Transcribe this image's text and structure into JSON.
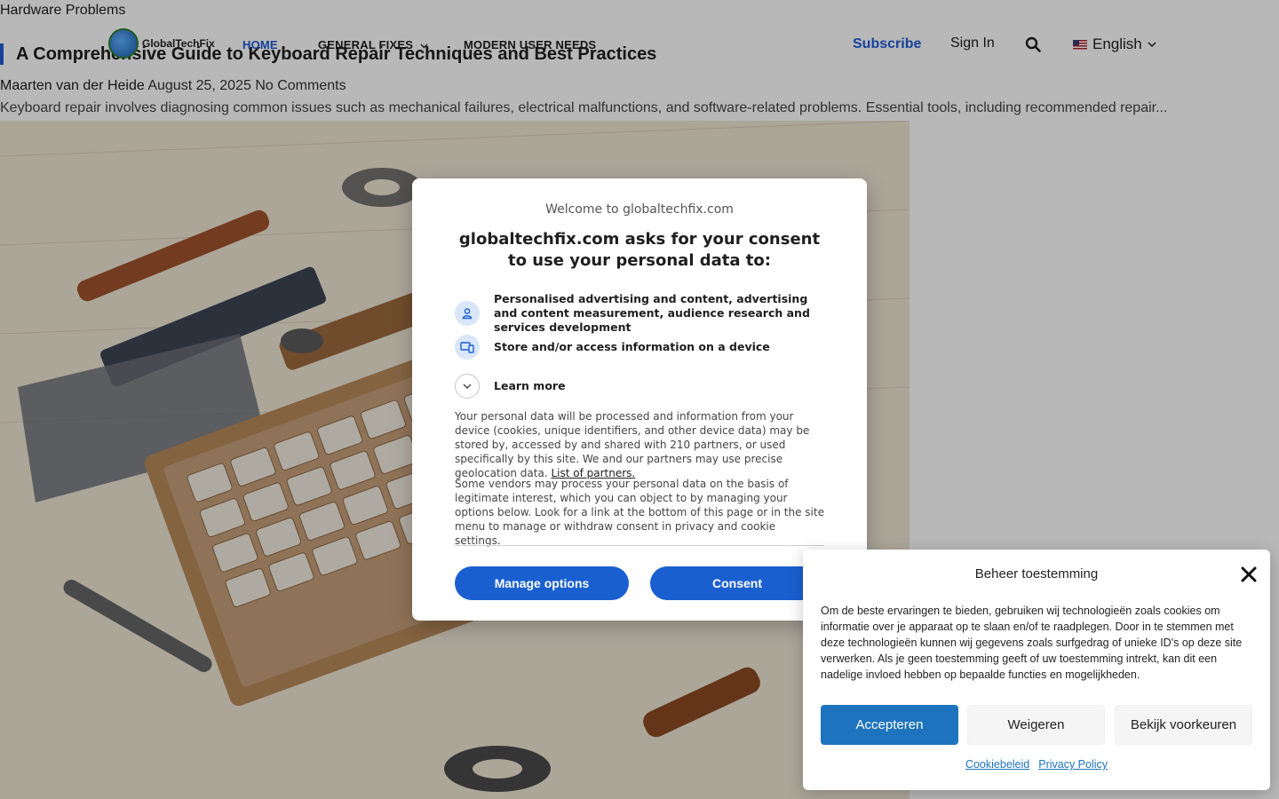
{
  "category": "Hardware Problems",
  "header": {
    "logo_text": "GlobalTechFix",
    "nav": [
      "HOME",
      "GENERAL FIXES",
      "MODERN USER NEEDS"
    ],
    "subscribe": "Subscribe",
    "signin": "Sign In",
    "language": "English"
  },
  "post": {
    "title": "A Comprehensive Guide to Keyboard Repair Techniques and Best Practices",
    "author": "Maarten van der Heide",
    "date": "August 25, 2025",
    "comments": "No Comments",
    "excerpt": "Keyboard repair involves diagnosing common issues such as mechanical failures, electrical malfunctions, and software-related problems. Essential tools, including recommended repair..."
  },
  "consent_modal": {
    "welcome": "Welcome to globaltechfix.com",
    "heading": "globaltechfix.com asks for your consent to use your personal data to:",
    "purposes": [
      "Personalised advertising and content, advertising and content measurement, audience research and services development",
      "Store and/or access information on a device",
      "Learn more"
    ],
    "body1": "Your personal data will be processed and information from your device (cookies, unique identifiers, and other device data) may be stored by, accessed by and shared with 210 partners, or used specifically by this site. We and our partners may use precise geolocation data.",
    "partners_link": "List of partners.",
    "body2": "Some vendors may process your personal data on the basis of legitimate interest, which you can object to by managing your options below. Look for a link at the bottom of this page or in the site menu to manage or withdraw consent in privacy and cookie settings.",
    "manage_button": "Manage options",
    "consent_button": "Consent"
  },
  "cookie_panel": {
    "title": "Beheer toestemming",
    "text": "Om de beste ervaringen te bieden, gebruiken wij technologieën zoals cookies om informatie over je apparaat op te slaan en/of te raadplegen. Door in te stemmen met deze technologieën kunnen wij gegevens zoals surfgedrag of unieke ID's op deze site verwerken. Als je geen toestemming geeft of uw toestemming intrekt, kan dit een nadelige invloed hebben op bepaalde functies en mogelijkheden.",
    "accept": "Accepteren",
    "deny": "Weigeren",
    "preferences": "Bekijk voorkeuren",
    "link_cookie": "Cookiebeleid",
    "link_privacy": "Privacy Policy"
  },
  "colors": {
    "accent": "#1f5bd6",
    "modal_button": "#1a5fd0",
    "cookie_accept": "#1e73be"
  }
}
